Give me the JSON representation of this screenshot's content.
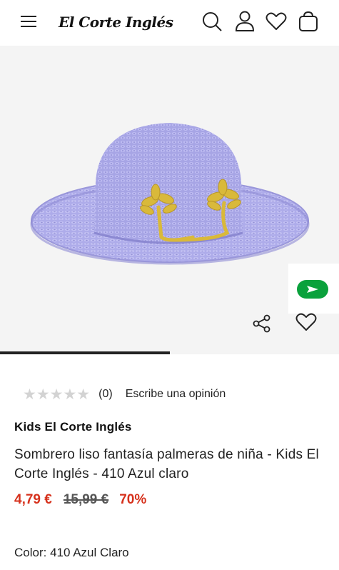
{
  "header": {
    "logo_text": "El Corte Inglés"
  },
  "icons": {
    "menu": "hamburger-menu-icon",
    "search": "search-icon",
    "account": "user-icon",
    "wishlist": "heart-icon",
    "bag": "shopping-bag-icon",
    "share": "share-icon",
    "favorite": "heart-outline-icon",
    "chat": "send-arrow-icon"
  },
  "gallery": {
    "progress": 0.5
  },
  "rating": {
    "stars": "★★★★★",
    "count": "(0)",
    "write_review": "Escribe una opinión"
  },
  "product": {
    "brand": "Kids El Corte Inglés",
    "title": "Sombrero liso fantasía palmeras de niña - Kids El Corte Inglés - 410 Azul claro",
    "price_now": "4,79 €",
    "price_old": "15,99 €",
    "discount": "70%",
    "color_label": "Color: 410 Azul Claro"
  },
  "colors": {
    "accent_red": "#d6311c",
    "chat_green": "#0aa13c",
    "hat_lavender": "#a6a6e6",
    "palm_yellow": "#d9b93a"
  }
}
